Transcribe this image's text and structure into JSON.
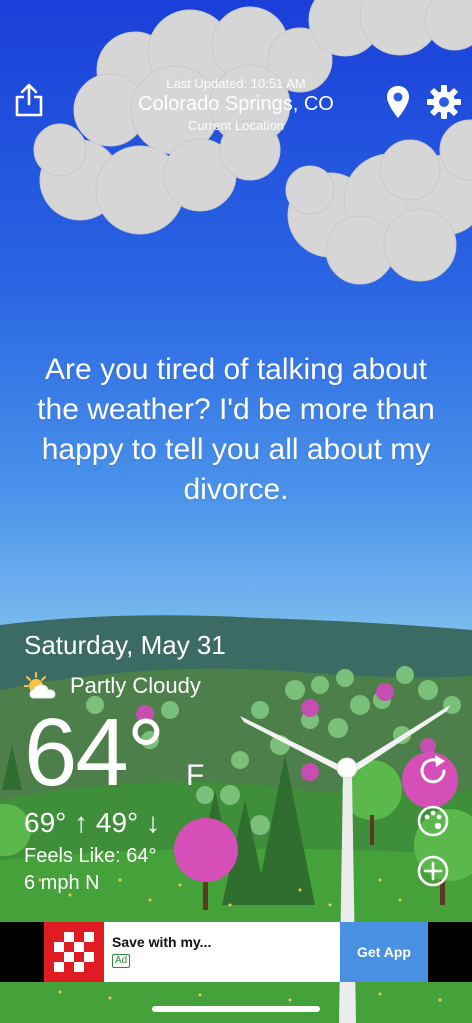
{
  "header": {
    "last_updated": "Last Updated: 10:51 AM",
    "city": "Colorado Springs, CO",
    "current_location": "Current Location",
    "share_icon": "share-icon",
    "location_icon": "location-pin-icon",
    "settings_icon": "gear-icon"
  },
  "message": "Are you tired of talking about the weather? I'd be more than happy to tell you all about my divorce.",
  "weather": {
    "date": "Saturday, May 31",
    "condition": "Partly Cloudy",
    "condition_icon": "partly-cloudy-icon",
    "temperature": "64°",
    "unit": "F",
    "high_low": "69° ↑  49° ↓",
    "feels_like": "Feels Like: 64°",
    "wind": "6 mph N"
  },
  "side_buttons": [
    {
      "icon": "refresh-icon"
    },
    {
      "icon": "palette-icon"
    },
    {
      "icon": "add-circle-icon"
    }
  ],
  "ad": {
    "title": "Save with my...",
    "badge": "Ad",
    "cta": "Get App"
  },
  "colors": {
    "sky_top": "#1a3fd9",
    "sky_bottom": "#a9d6f1",
    "grass": "#3f8f3a",
    "ad_cta": "#4a90e2",
    "ad_logo": "#e11b22"
  }
}
